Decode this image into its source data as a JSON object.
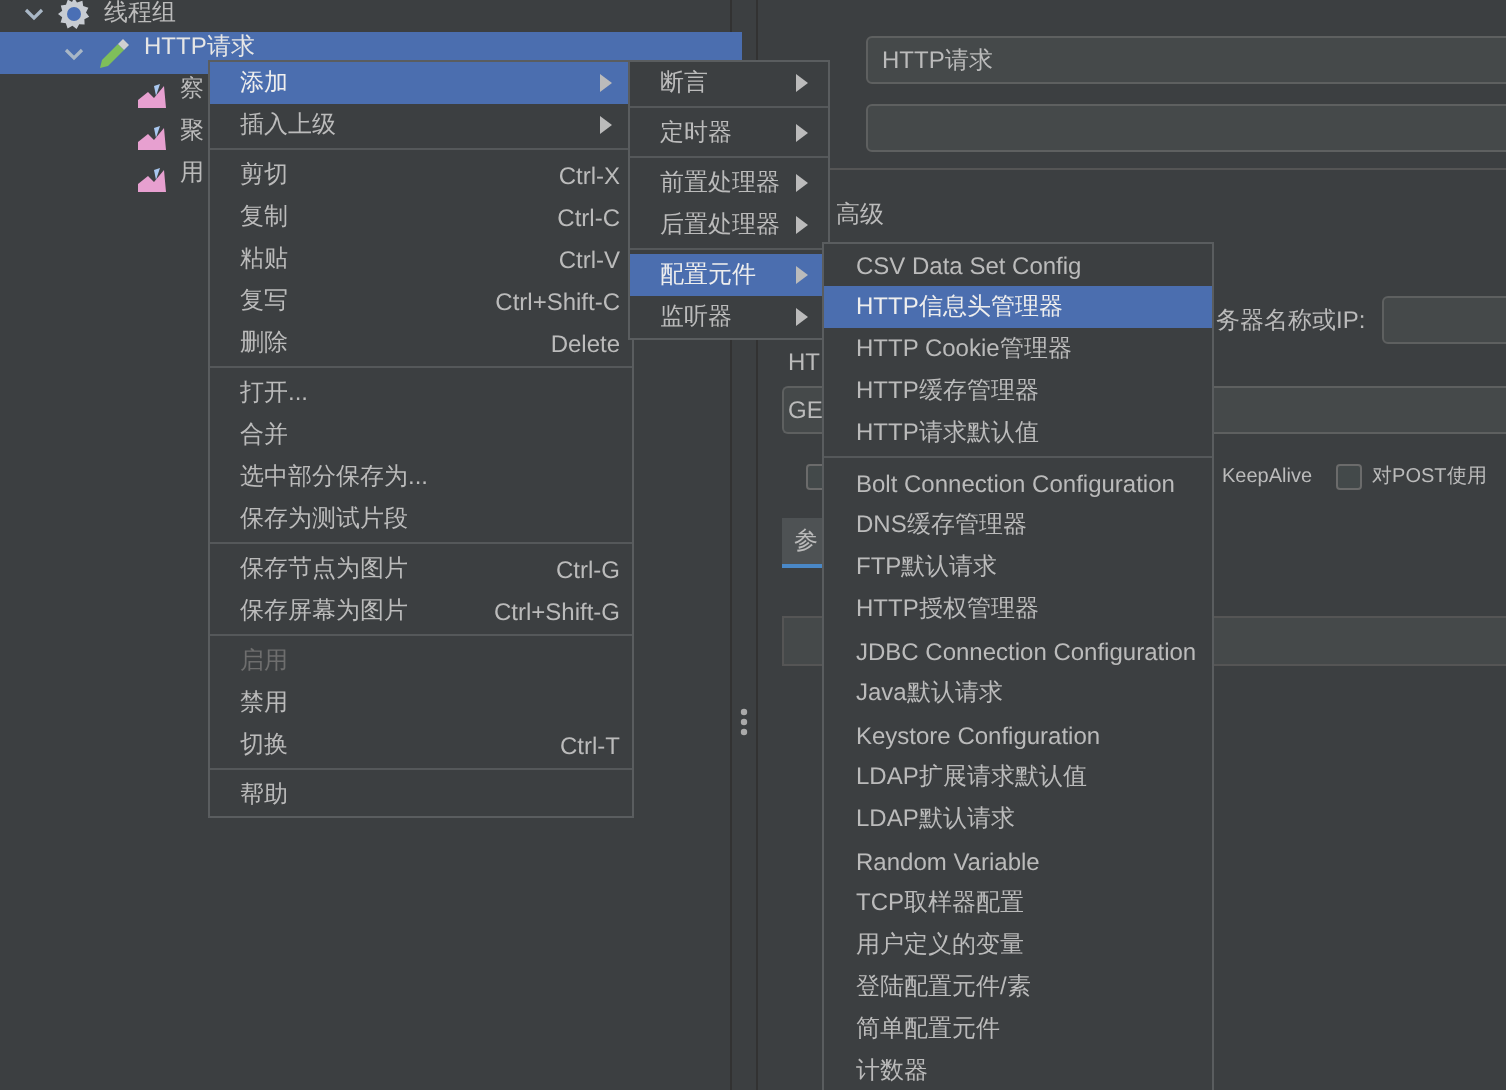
{
  "tree": [
    {
      "label": "线程组",
      "kind": "thread-group",
      "expanded": true,
      "selected": false,
      "children": [
        {
          "label": "HTTP请求",
          "kind": "sampler",
          "expanded": true,
          "selected": true,
          "children": [
            {
              "label": "察",
              "kind": "listener",
              "selected": false
            },
            {
              "label": "聚",
              "kind": "listener",
              "selected": false
            },
            {
              "label": "用",
              "kind": "listener",
              "selected": false
            }
          ]
        }
      ]
    }
  ],
  "editor": {
    "name_value": "HTTP请求",
    "tab": "高级",
    "server_label": "务器名称或IP:",
    "group_label": "HT",
    "method": "GE",
    "options": [
      {
        "checked": false
      },
      {
        "label": "KeepAlive"
      },
      {
        "label": "对POST使用",
        "checked": false
      }
    ],
    "params_tab": "参"
  },
  "context_menu": {
    "items": [
      {
        "kind": "item",
        "label": "添加",
        "submenu": true,
        "selected": true,
        "disabled": false
      },
      {
        "kind": "item",
        "label": "插入上级",
        "submenu": true,
        "selected": false,
        "disabled": false
      },
      {
        "kind": "separator"
      },
      {
        "kind": "item",
        "label": "剪切",
        "shortcut": "Ctrl-X",
        "selected": false,
        "disabled": false
      },
      {
        "kind": "item",
        "label": "复制",
        "shortcut": "Ctrl-C",
        "selected": false,
        "disabled": false
      },
      {
        "kind": "item",
        "label": "粘贴",
        "shortcut": "Ctrl-V",
        "selected": false,
        "disabled": false
      },
      {
        "kind": "item",
        "label": "复写",
        "shortcut": "Ctrl+Shift-C",
        "selected": false,
        "disabled": false
      },
      {
        "kind": "item",
        "label": "删除",
        "shortcut": "Delete",
        "selected": false,
        "disabled": false
      },
      {
        "kind": "separator"
      },
      {
        "kind": "item",
        "label": "打开...",
        "selected": false,
        "disabled": false
      },
      {
        "kind": "item",
        "label": "合并",
        "selected": false,
        "disabled": false
      },
      {
        "kind": "item",
        "label": "选中部分保存为...",
        "selected": false,
        "disabled": false
      },
      {
        "kind": "item",
        "label": "保存为测试片段",
        "selected": false,
        "disabled": false
      },
      {
        "kind": "separator"
      },
      {
        "kind": "item",
        "label": "保存节点为图片",
        "shortcut": "Ctrl-G",
        "selected": false,
        "disabled": false
      },
      {
        "kind": "item",
        "label": "保存屏幕为图片",
        "shortcut": "Ctrl+Shift-G",
        "selected": false,
        "disabled": false
      },
      {
        "kind": "separator"
      },
      {
        "kind": "item",
        "label": "启用",
        "selected": false,
        "disabled": true
      },
      {
        "kind": "item",
        "label": "禁用",
        "selected": false,
        "disabled": false
      },
      {
        "kind": "item",
        "label": "切换",
        "shortcut": "Ctrl-T",
        "selected": false,
        "disabled": false
      },
      {
        "kind": "separator"
      },
      {
        "kind": "item",
        "label": "帮助",
        "selected": false,
        "disabled": false
      }
    ]
  },
  "add_submenu": {
    "items": [
      {
        "kind": "item",
        "label": "断言",
        "submenu": true,
        "selected": false
      },
      {
        "kind": "separator"
      },
      {
        "kind": "item",
        "label": "定时器",
        "submenu": true,
        "selected": false
      },
      {
        "kind": "separator"
      },
      {
        "kind": "item",
        "label": "前置处理器",
        "submenu": true,
        "selected": false
      },
      {
        "kind": "item",
        "label": "后置处理器",
        "submenu": true,
        "selected": false
      },
      {
        "kind": "separator"
      },
      {
        "kind": "item",
        "label": "配置元件",
        "submenu": true,
        "selected": true
      },
      {
        "kind": "item",
        "label": "监听器",
        "submenu": true,
        "selected": false
      }
    ]
  },
  "config_submenu": {
    "items": [
      {
        "kind": "item",
        "label": "CSV Data Set Config",
        "selected": false
      },
      {
        "kind": "item",
        "label": "HTTP信息头管理器",
        "selected": true
      },
      {
        "kind": "item",
        "label": "HTTP Cookie管理器",
        "selected": false
      },
      {
        "kind": "item",
        "label": "HTTP缓存管理器",
        "selected": false
      },
      {
        "kind": "item",
        "label": "HTTP请求默认值",
        "selected": false
      },
      {
        "kind": "separator"
      },
      {
        "kind": "item",
        "label": "Bolt Connection Configuration",
        "selected": false
      },
      {
        "kind": "item",
        "label": "DNS缓存管理器",
        "selected": false
      },
      {
        "kind": "item",
        "label": "FTP默认请求",
        "selected": false
      },
      {
        "kind": "item",
        "label": "HTTP授权管理器",
        "selected": false
      },
      {
        "kind": "item",
        "label": "JDBC Connection Configuration",
        "selected": false
      },
      {
        "kind": "item",
        "label": "Java默认请求",
        "selected": false
      },
      {
        "kind": "item",
        "label": "Keystore Configuration",
        "selected": false
      },
      {
        "kind": "item",
        "label": "LDAP扩展请求默认值",
        "selected": false
      },
      {
        "kind": "item",
        "label": "LDAP默认请求",
        "selected": false
      },
      {
        "kind": "item",
        "label": "Random Variable",
        "selected": false
      },
      {
        "kind": "item",
        "label": "TCP取样器配置",
        "selected": false
      },
      {
        "kind": "item",
        "label": "用户定义的变量",
        "selected": false
      },
      {
        "kind": "item",
        "label": "登陆配置元件/素",
        "selected": false
      },
      {
        "kind": "item",
        "label": "简单配置元件",
        "selected": false
      },
      {
        "kind": "item",
        "label": "计数器",
        "selected": false
      }
    ]
  }
}
